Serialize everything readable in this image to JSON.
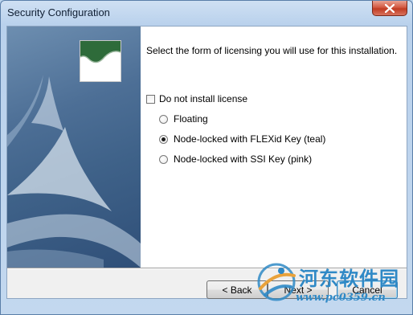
{
  "window": {
    "title": "Security Configuration"
  },
  "content": {
    "instruction": "Select the form of licensing you will use for this installation.",
    "no_license_checkbox": {
      "label": "Do not install license",
      "checked": false
    },
    "license_options": [
      {
        "label": "Floating",
        "selected": false
      },
      {
        "label": "Node-locked with FLEXid Key (teal)",
        "selected": true
      },
      {
        "label": "Node-locked with SSI Key (pink)",
        "selected": false
      }
    ]
  },
  "buttons": {
    "back": "< Back",
    "next": "Next >",
    "cancel": "Cancel"
  },
  "watermark": {
    "site_name": "河东软件园",
    "url": "www.pc0359.cn"
  },
  "colors": {
    "accent": "#2f89c6",
    "logo_green": "#2e6b3a"
  },
  "icons": {
    "close": "close-icon",
    "watermark": "watermark-logo-icon"
  }
}
